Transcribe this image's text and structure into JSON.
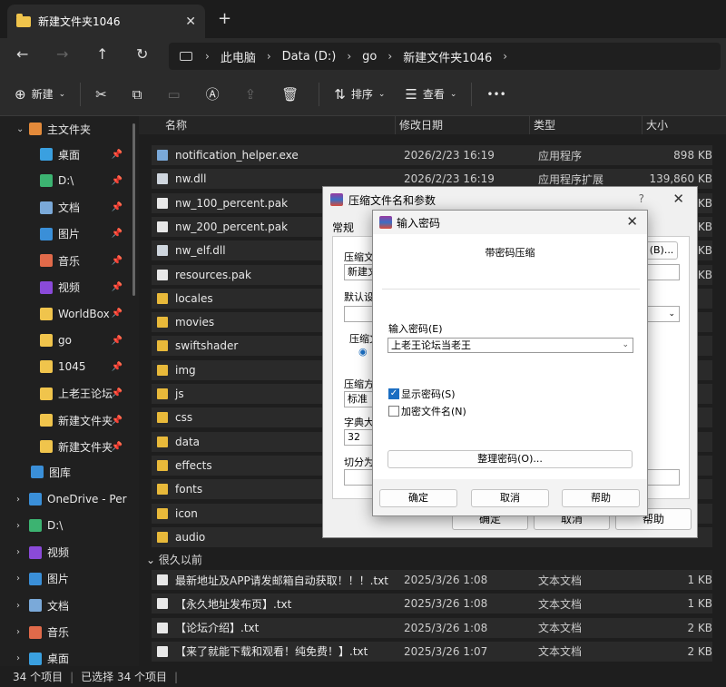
{
  "tab": {
    "title": "新建文件夹1046",
    "close": "✕",
    "new": "+"
  },
  "address": {
    "crumbs": [
      "此电脑",
      "Data (D:)",
      "go",
      "新建文件夹1046"
    ]
  },
  "toolbar": {
    "new_label": "新建",
    "sort_label": "排序",
    "view_label": "查看",
    "more": "•••"
  },
  "sidebar": {
    "home": "主文件夹",
    "quick": [
      {
        "label": "桌面",
        "color": "#3aa0e0"
      },
      {
        "label": "D:\\",
        "color": "#3cb371"
      },
      {
        "label": "文档",
        "color": "#7aa9d9"
      },
      {
        "label": "图片",
        "color": "#3a8fd8"
      },
      {
        "label": "音乐",
        "color": "#e06a4a"
      },
      {
        "label": "视频",
        "color": "#8a4ad9"
      },
      {
        "label": "WorldBox",
        "color": "#f0c44c"
      },
      {
        "label": "go",
        "color": "#f0c44c"
      },
      {
        "label": "1045",
        "color": "#f0c44c"
      },
      {
        "label": "上老王论坛",
        "color": "#f0c44c"
      },
      {
        "label": "新建文件夹",
        "color": "#f0c44c"
      },
      {
        "label": "新建文件夹",
        "color": "#f0c44c"
      }
    ],
    "gallery": "图库",
    "roots": [
      {
        "label": "OneDrive - Per",
        "color": "#3a8fd8"
      },
      {
        "label": "D:\\",
        "color": "#3cb371"
      },
      {
        "label": "视频",
        "color": "#8a4ad9"
      },
      {
        "label": "图片",
        "color": "#3a8fd8"
      },
      {
        "label": "文档",
        "color": "#7aa9d9"
      },
      {
        "label": "音乐",
        "color": "#e06a4a"
      },
      {
        "label": "桌面",
        "color": "#3aa0e0"
      }
    ]
  },
  "columns": {
    "name": "名称",
    "date": "修改日期",
    "type": "类型",
    "size": "大小"
  },
  "files": [
    {
      "name": "notification_helper.exe",
      "date": "2026/2/23 16:19",
      "type": "应用程序",
      "size": "898 KB",
      "kind": "exe"
    },
    {
      "name": "nw.dll",
      "date": "2026/2/23 16:19",
      "type": "应用程序扩展",
      "size": "139,860 KB",
      "kind": "dll"
    },
    {
      "name": "nw_100_percent.pak",
      "date": "",
      "type": "",
      "size": "KB",
      "kind": "file"
    },
    {
      "name": "nw_200_percent.pak",
      "date": "",
      "type": "",
      "size": "KB",
      "kind": "file"
    },
    {
      "name": "nw_elf.dll",
      "date": "",
      "type": "",
      "size": "KB",
      "kind": "dll"
    },
    {
      "name": "resources.pak",
      "date": "",
      "type": "",
      "size": "KB",
      "kind": "file"
    },
    {
      "name": "locales",
      "date": "",
      "type": "",
      "size": "",
      "kind": "folder"
    },
    {
      "name": "movies",
      "date": "",
      "type": "",
      "size": "",
      "kind": "folder"
    },
    {
      "name": "swiftshader",
      "date": "",
      "type": "",
      "size": "",
      "kind": "folder"
    },
    {
      "name": "img",
      "date": "",
      "type": "",
      "size": "",
      "kind": "folder"
    },
    {
      "name": "js",
      "date": "",
      "type": "",
      "size": "",
      "kind": "folder"
    },
    {
      "name": "css",
      "date": "",
      "type": "",
      "size": "",
      "kind": "folder"
    },
    {
      "name": "data",
      "date": "",
      "type": "",
      "size": "",
      "kind": "folder"
    },
    {
      "name": "effects",
      "date": "",
      "type": "",
      "size": "",
      "kind": "folder"
    },
    {
      "name": "fonts",
      "date": "",
      "type": "",
      "size": "",
      "kind": "folder"
    },
    {
      "name": "icon",
      "date": "",
      "type": "",
      "size": "",
      "kind": "folder"
    },
    {
      "name": "audio",
      "date": "",
      "type": "",
      "size": "",
      "kind": "folder"
    }
  ],
  "group_old": "很久以前",
  "old_files": [
    {
      "name": "最新地址及APP请发邮箱自动获取！！！.txt",
      "date": "2025/3/26 1:08",
      "type": "文本文档",
      "size": "1 KB"
    },
    {
      "name": "【永久地址发布页】.txt",
      "date": "2025/3/26 1:08",
      "type": "文本文档",
      "size": "1 KB"
    },
    {
      "name": "【论坛介绍】.txt",
      "date": "2025/3/26 1:08",
      "type": "文本文档",
      "size": "2 KB"
    },
    {
      "name": "【来了就能下载和观看！纯免费！】.txt",
      "date": "2025/3/26 1:07",
      "type": "文本文档",
      "size": "2 KB"
    }
  ],
  "status": {
    "count": "34 个项目",
    "selected": "已选择 34 个项目"
  },
  "rar_dialog": {
    "title": "压缩文件名和参数",
    "help": "?",
    "tab_general": "常规",
    "archive_name_label": "压缩文件",
    "archive_name_value": "新建文",
    "browse_label": "(B)...",
    "profile_label": "默认设",
    "format_label": "压缩文",
    "method_label": "压缩方",
    "method_value": "标准",
    "dict_label": "字典大小",
    "dict_value": "32",
    "split_label": "切分为分",
    "ok": "确定",
    "cancel": "取消",
    "help_btn": "帮助"
  },
  "password_dialog": {
    "title": "输入密码",
    "heading": "带密码压缩",
    "input_label": "输入密码(E)",
    "input_value": "上老王论坛当老王",
    "show_password": "显示密码(S)",
    "encrypt_names": "加密文件名(N)",
    "organize": "整理密码(O)...",
    "ok": "确定",
    "cancel": "取消",
    "help": "帮助"
  }
}
